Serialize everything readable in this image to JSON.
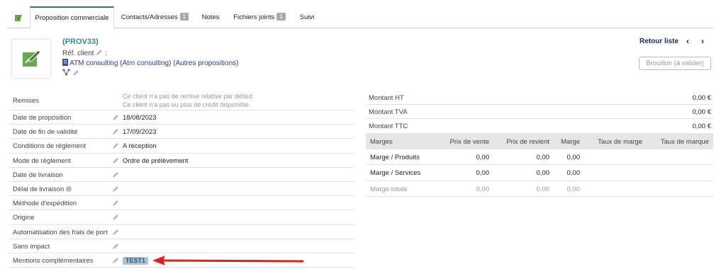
{
  "tabs": [
    {
      "label": "Proposition commerciale",
      "badge": null
    },
    {
      "label": "Contacts/Adresses",
      "badge": "1"
    },
    {
      "label": "Notes",
      "badge": null
    },
    {
      "label": "Fichiers joints",
      "badge": "1"
    },
    {
      "label": "Suivi",
      "badge": null
    }
  ],
  "header": {
    "ref": "(PROV33)",
    "ref_client_label": "Réf. client",
    "ref_client_colon": ":",
    "thirdparty": "ATM consulting (Atm consulting) (Autres propositions)",
    "back_label": "Retour liste",
    "prev": "‹",
    "next": "›",
    "status": "Brouillon (à valider)"
  },
  "left_fields": {
    "remises": {
      "label": "Remises",
      "line1": "Ce client n'a pas de remise relative par défaut.",
      "line2": "Ce client n'a pas ou plus de crédit disponible."
    },
    "date_proposition": {
      "label": "Date de proposition",
      "value": "18/08/2023"
    },
    "date_fin_validite": {
      "label": "Date de fin de validité",
      "value": "17/09/2023"
    },
    "conditions_reglement": {
      "label": "Conditions de règlement",
      "value": "A réception"
    },
    "mode_reglement": {
      "label": "Mode de règlement",
      "value": "Ordre de prélèvement"
    },
    "date_livraison": {
      "label": "Date de livraison",
      "value": ""
    },
    "delai_livraison": {
      "label": "Délai de livraison",
      "value": ""
    },
    "methode_expedition": {
      "label": "Méthode d'expédition",
      "value": ""
    },
    "origine": {
      "label": "Origine",
      "value": ""
    },
    "automatisation": {
      "label": "Automatisation des frais de port",
      "value": ""
    },
    "sans_impact": {
      "label": "Sans impact",
      "value": ""
    },
    "mentions": {
      "label": "Mentions complémentaires",
      "tag": "TEST1"
    }
  },
  "totals": {
    "ht": {
      "label": "Montant HT",
      "value": "0,00 €"
    },
    "tva": {
      "label": "Montant TVA",
      "value": "0,00 €"
    },
    "ttc": {
      "label": "Montant TTC",
      "value": "0,00 €"
    }
  },
  "margins": {
    "headers": [
      "Marges",
      "Prix de vente",
      "Prix de revient",
      "Marge",
      "Taux de marge",
      "Taux de marque"
    ],
    "rows": [
      {
        "label": "Marge / Produits",
        "vente": "0,00",
        "revient": "0,00",
        "marge": "0,00"
      },
      {
        "label": "Marge / Services",
        "vente": "0,00",
        "revient": "0,00",
        "marge": "0,00"
      },
      {
        "label": "Marge totale",
        "vente": "0,00",
        "revient": "0,00",
        "marge": "0,00"
      }
    ]
  },
  "colors": {
    "accent": "#2a8f8a",
    "link": "#263c8c",
    "arrow": "#e0201c",
    "tag_bg": "#aac2d6"
  }
}
